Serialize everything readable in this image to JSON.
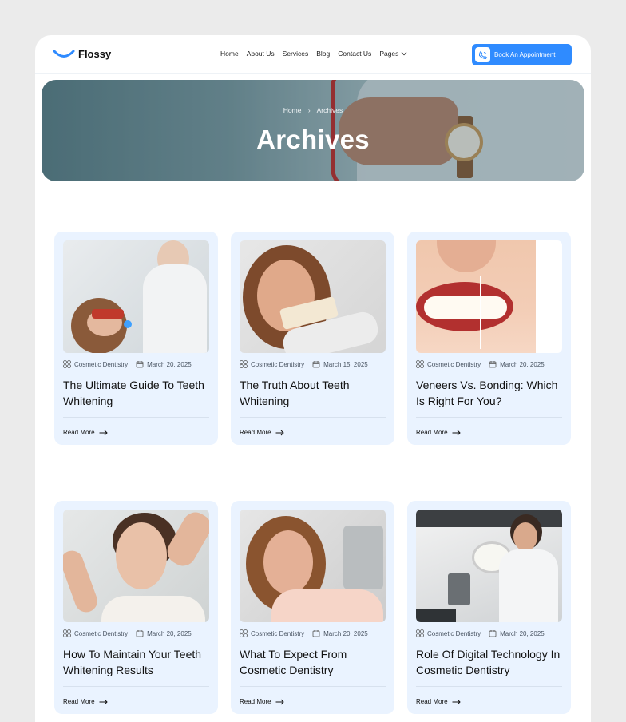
{
  "header": {
    "logo_text": "Flossy",
    "nav": [
      "Home",
      "About Us",
      "Services",
      "Blog",
      "Contact Us",
      "Pages"
    ],
    "cta_label": "Book An Appointment"
  },
  "hero": {
    "breadcrumb": [
      "Home",
      "Archives"
    ],
    "title": "Archives"
  },
  "posts": [
    {
      "category": "Cosmetic Dentistry",
      "date": "March 20, 2025",
      "title": "The Ultimate Guide To Teeth Whitening",
      "read_more": "Read More"
    },
    {
      "category": "Cosmetic Dentistry",
      "date": "March 15, 2025",
      "title": "The Truth About Teeth Whitening",
      "read_more": "Read More"
    },
    {
      "category": "Cosmetic Dentistry",
      "date": "March 20, 2025",
      "title": "Veneers Vs. Bonding: Which Is Right For You?",
      "read_more": "Read More"
    },
    {
      "category": "Cosmetic Dentistry",
      "date": "March 20, 2025",
      "title": "How To Maintain Your Teeth Whitening Results",
      "read_more": "Read More"
    },
    {
      "category": "Cosmetic Dentistry",
      "date": "March 20, 2025",
      "title": "What To Expect From Cosmetic Dentistry",
      "read_more": "Read More"
    },
    {
      "category": "Cosmetic Dentistry",
      "date": "March 20, 2025",
      "title": "Role Of Digital Technology In Cosmetic Dentistry",
      "read_more": "Read More"
    }
  ],
  "colors": {
    "accent": "#2f8bff",
    "card_bg": "#eaf3ff",
    "page_bg": "#ebebeb"
  },
  "icons": {
    "category": "category-grid-icon",
    "date": "calendar-icon",
    "read_more": "arrow-right-icon",
    "cta": "phone-icon",
    "dropdown": "chevron-down-icon"
  }
}
